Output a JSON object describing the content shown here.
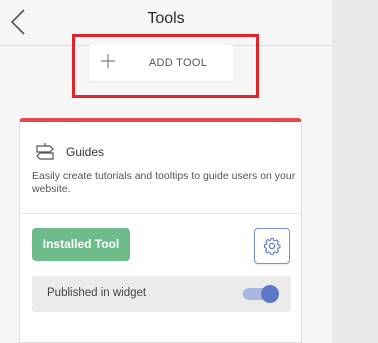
{
  "header": {
    "title": "Tools",
    "back_icon": "chevron-left-icon"
  },
  "add_tool": {
    "label": "ADD TOOL",
    "icon": "plus-icon",
    "highlight_color": "#e0242b"
  },
  "tool_card": {
    "title": "Guides",
    "icon": "signpost-icon",
    "description": "Easily create tutorials and tooltips to guide users on your website.",
    "accent_color": "#e8474d",
    "installed_button": "Installed Tool",
    "installed_color": "#6dbc8a",
    "settings_icon": "gear-icon",
    "published": {
      "label": "Published in widget",
      "enabled": true,
      "toggle_color": "#5d78c8"
    }
  }
}
